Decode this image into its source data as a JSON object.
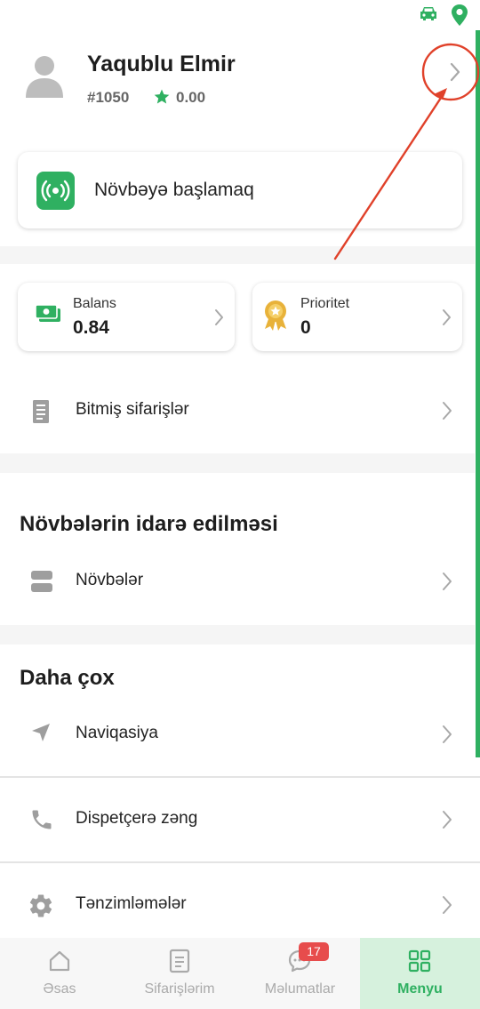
{
  "colors": {
    "accent": "#2fb061",
    "badge": "#e74c4c",
    "annotation": "#e0412a",
    "gold": "#e8b23a"
  },
  "profile": {
    "name": "Yaqublu Elmir",
    "id": "#1050",
    "rating": "0.00"
  },
  "queue": {
    "label": "Növbəyə başlamaq",
    "icon": "broadcast-icon"
  },
  "cards": {
    "balance": {
      "title": "Balans",
      "value": "0.84",
      "icon": "money-icon"
    },
    "priority": {
      "title": "Prioritet",
      "value": "0",
      "icon": "medal-icon"
    }
  },
  "rows": {
    "completed": {
      "label": "Bitmiş sifarişlər",
      "icon": "receipt-icon"
    },
    "shifts": {
      "label": "Növbələr",
      "icon": "server-icon"
    },
    "navigation": {
      "label": "Naviqasiya",
      "icon": "navigation-arrow-icon"
    },
    "dispatcher": {
      "label": "Dispetçerə zəng",
      "icon": "phone-icon"
    },
    "settings": {
      "label": "Tənzimləmələr",
      "icon": "gear-icon"
    }
  },
  "sections": {
    "shift_management": "Növbələrin idarə edilməsi",
    "more": "Daha çox"
  },
  "bottom_nav": [
    {
      "label": "Əsas",
      "icon": "home-icon",
      "active": false
    },
    {
      "label": "Sifarişlərim",
      "icon": "document-icon",
      "active": false
    },
    {
      "label": "Məlumatlar",
      "icon": "chat-icon",
      "active": false,
      "badge": "17"
    },
    {
      "label": "Menyu",
      "icon": "grid-icon",
      "active": true
    }
  ]
}
